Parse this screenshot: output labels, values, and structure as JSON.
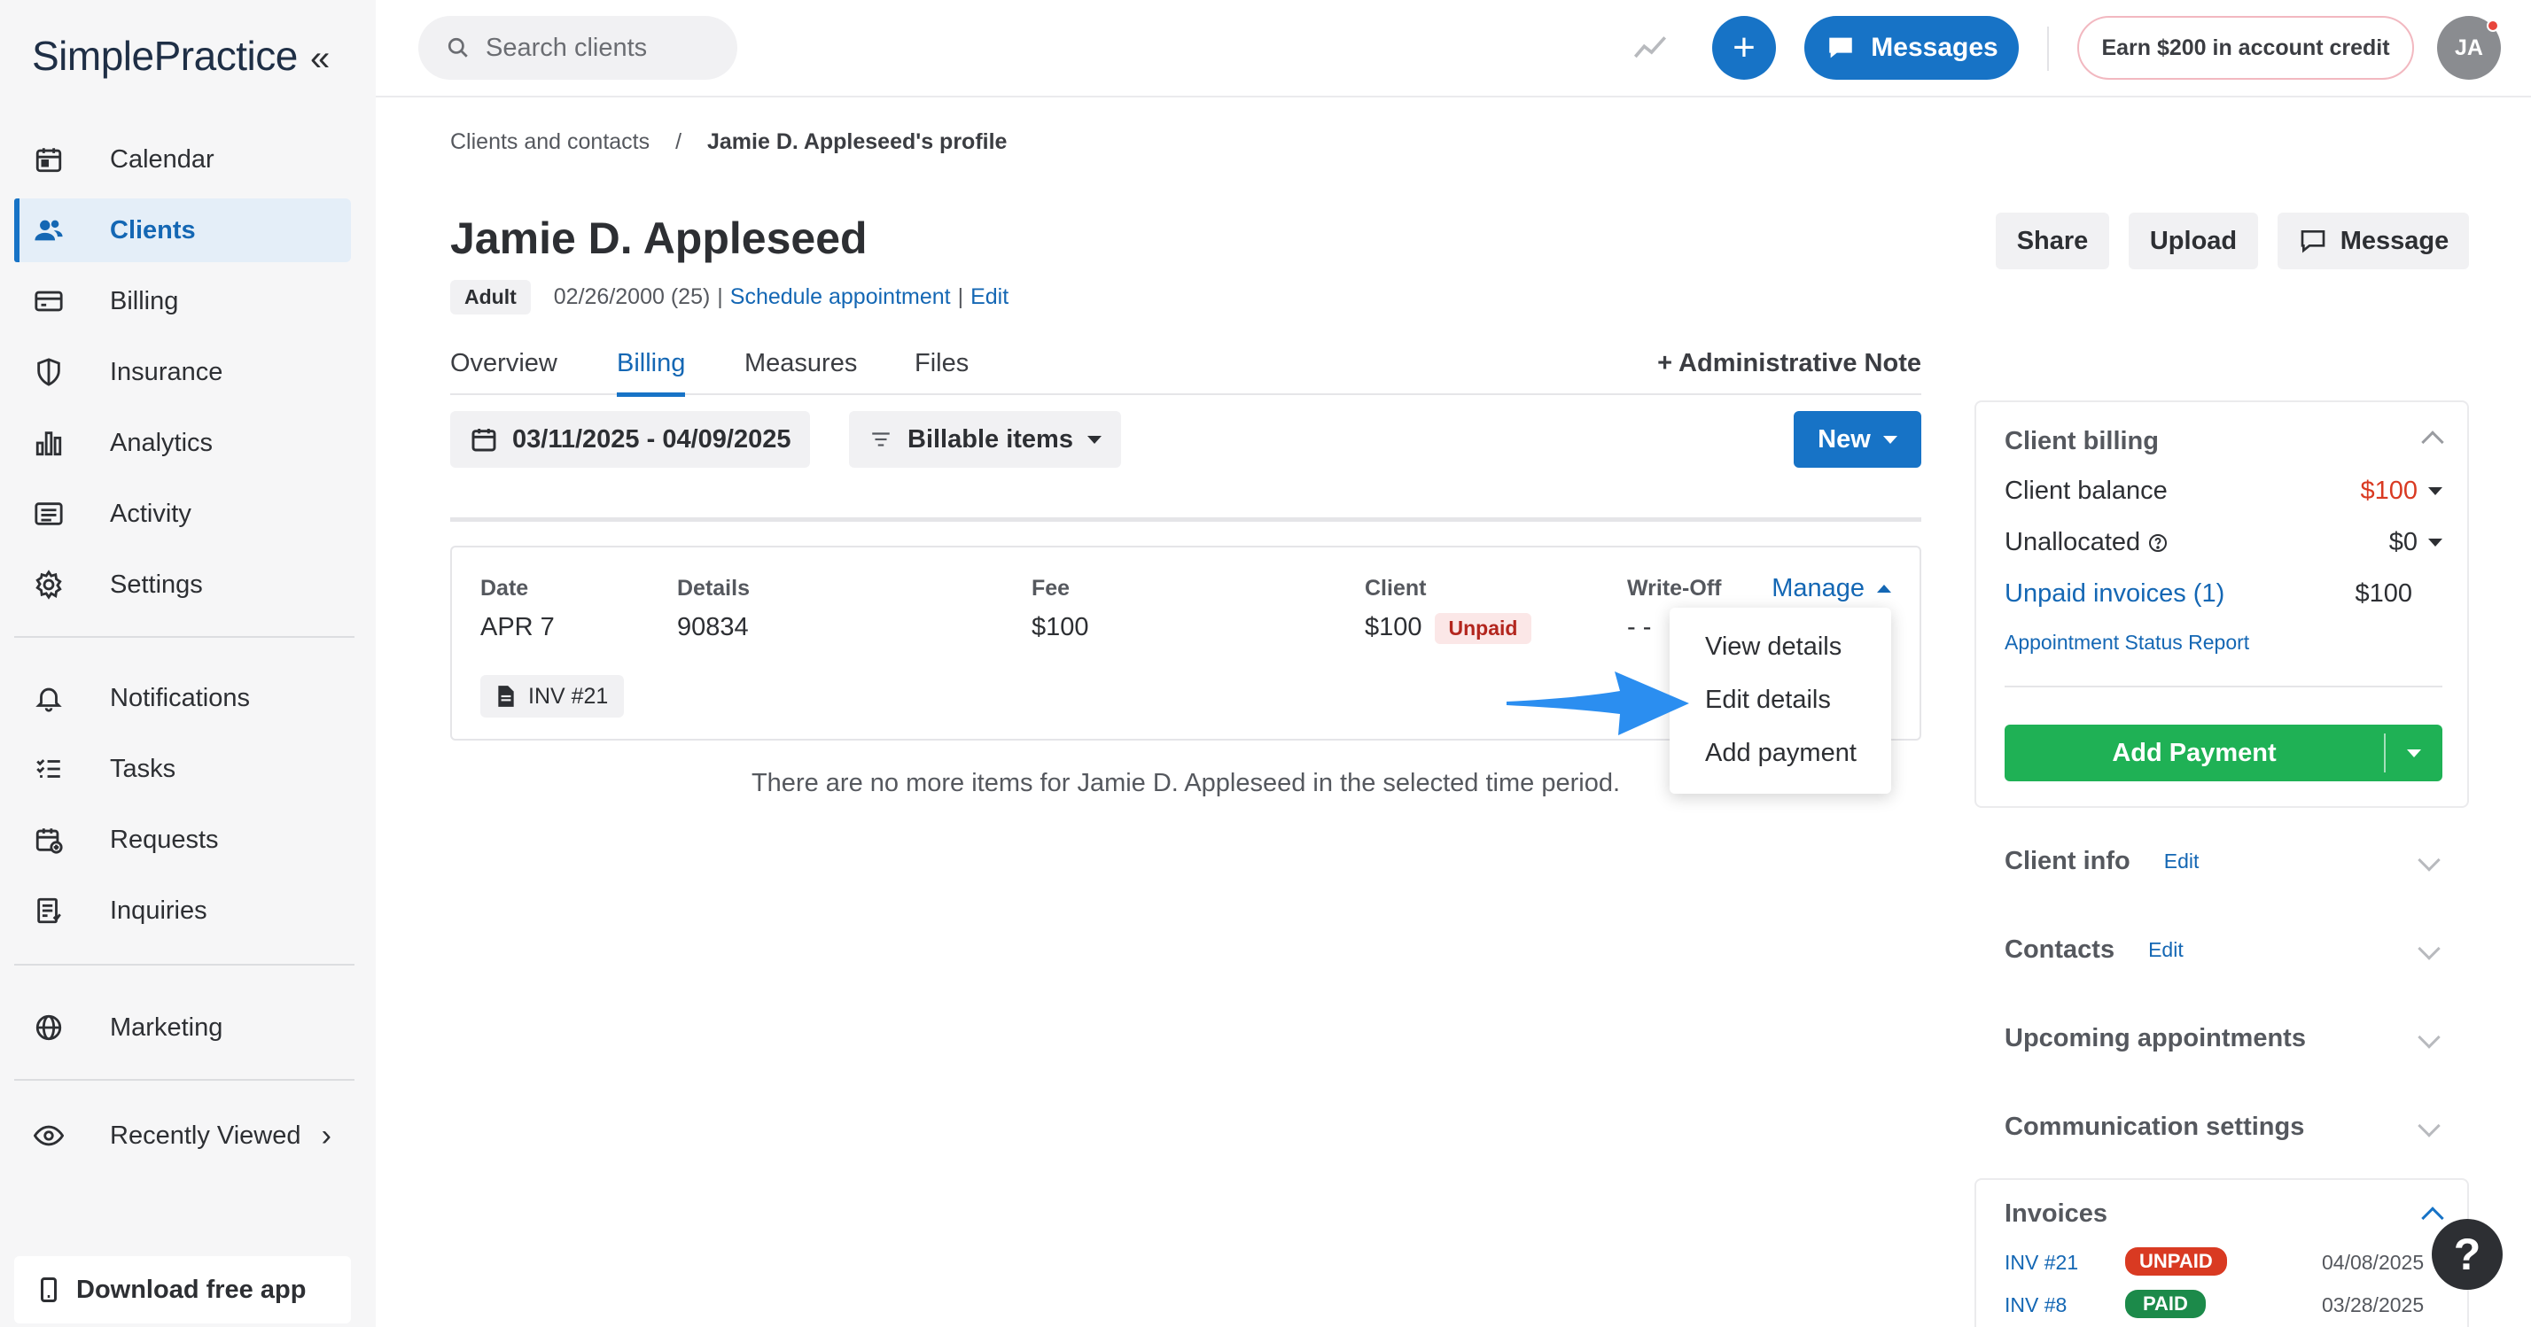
{
  "app": {
    "logo": "SimplePractice"
  },
  "sidebar": {
    "items": [
      {
        "label": "Calendar",
        "icon": "calendar-icon"
      },
      {
        "label": "Clients",
        "icon": "users-icon",
        "active": true
      },
      {
        "label": "Billing",
        "icon": "credit-card-icon"
      },
      {
        "label": "Insurance",
        "icon": "shield-icon"
      },
      {
        "label": "Analytics",
        "icon": "bar-chart-icon"
      },
      {
        "label": "Activity",
        "icon": "list-icon"
      },
      {
        "label": "Settings",
        "icon": "gear-icon"
      }
    ],
    "secondary": [
      {
        "label": "Notifications",
        "icon": "bell-icon"
      },
      {
        "label": "Tasks",
        "icon": "checklist-icon"
      },
      {
        "label": "Requests",
        "icon": "calendar-plus-icon"
      },
      {
        "label": "Inquiries",
        "icon": "document-list-icon"
      }
    ],
    "marketing": {
      "label": "Marketing",
      "icon": "globe-icon"
    },
    "recently_viewed": {
      "label": "Recently Viewed",
      "icon": "eye-icon"
    },
    "download_app": "Download free app"
  },
  "topbar": {
    "search_placeholder": "Search clients",
    "messages_label": "Messages",
    "earn_label": "Earn $200 in account credit",
    "avatar_initials": "JA"
  },
  "breadcrumb": {
    "parent": "Clients and contacts",
    "current": "Jamie D. Appleseed's profile"
  },
  "client": {
    "name": "Jamie D. Appleseed",
    "age_group": "Adult",
    "dob": "02/26/2000 (25)",
    "schedule_link": "Schedule appointment",
    "edit_link": "Edit"
  },
  "actions": {
    "share": "Share",
    "upload": "Upload",
    "message": "Message"
  },
  "tabs": {
    "overview": "Overview",
    "billing": "Billing",
    "measures": "Measures",
    "files": "Files",
    "admin_note": "Administrative Note"
  },
  "filters": {
    "date_range": "03/11/2025 - 04/09/2025",
    "billable": "Billable items",
    "new": "New"
  },
  "billing_item": {
    "headers": {
      "date": "Date",
      "details": "Details",
      "fee": "Fee",
      "client": "Client",
      "writeoff": "Write-Off"
    },
    "date": "APR 7",
    "details": "90834",
    "fee": "$100",
    "client_amount": "$100",
    "client_status": "Unpaid",
    "writeoff": "- -",
    "manage": "Manage",
    "invoice_chip": "INV #21"
  },
  "manage_menu": {
    "view": "View details",
    "edit": "Edit details",
    "add_payment": "Add payment"
  },
  "no_more_items": "There are no more items for Jamie D. Appleseed in the selected time period.",
  "client_billing": {
    "title": "Client billing",
    "balance_label": "Client balance",
    "balance_value": "$100",
    "unallocated_label": "Unallocated",
    "unallocated_value": "$0",
    "unpaid_label": "Unpaid invoices (1)",
    "unpaid_value": "$100",
    "report_link": "Appointment Status Report",
    "add_payment": "Add Payment"
  },
  "sections": {
    "client_info": "Client info",
    "contacts": "Contacts",
    "upcoming": "Upcoming appointments",
    "communication": "Communication settings",
    "edit": "Edit"
  },
  "invoices": {
    "title": "Invoices",
    "rows": [
      {
        "id": "INV #21",
        "status": "UNPAID",
        "date": "04/08/2025",
        "color": "#d93a22"
      },
      {
        "id": "INV #8",
        "status": "PAID",
        "date": "03/28/2025",
        "color": "#1c8a4a"
      }
    ]
  },
  "help": "?"
}
